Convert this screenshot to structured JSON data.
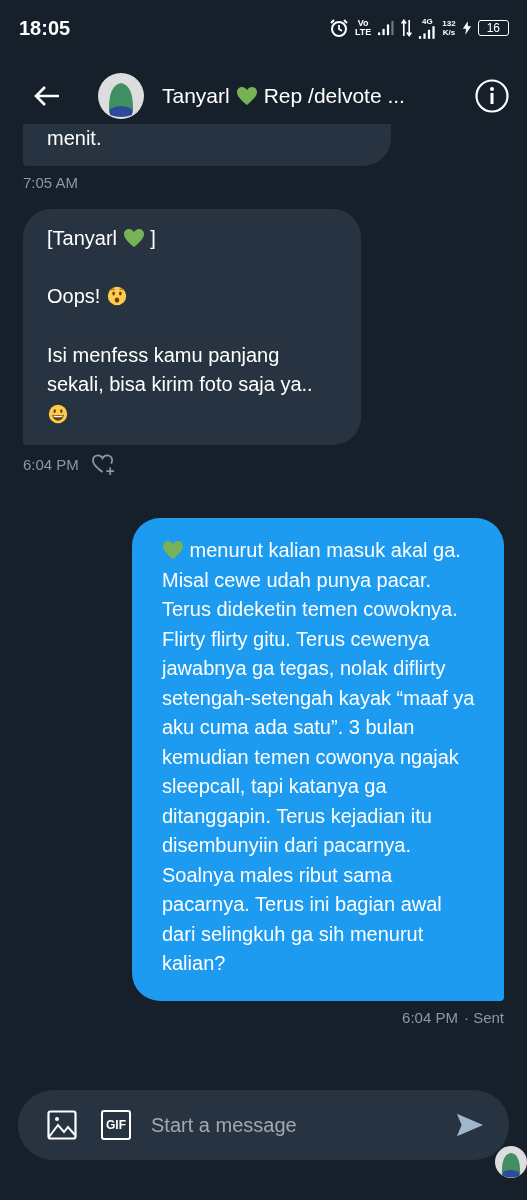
{
  "status_bar": {
    "time": "18:05",
    "volte_top": "Vo",
    "volte_bottom": "LTE",
    "network": "4G",
    "speed_value": "132",
    "speed_unit": "K/s",
    "battery": "16"
  },
  "header": {
    "name": "Tanyarl",
    "subtitle": "Rep /delvote ..."
  },
  "messages": [
    {
      "kind": "received",
      "paragraphs": [
        [
          {
            "kind": "text",
            "text": "menit."
          }
        ]
      ],
      "time": "7:05 AM",
      "partial": true,
      "react": false
    },
    {
      "kind": "received",
      "paragraphs": [
        [
          {
            "kind": "text",
            "text": "[Tanyarl"
          },
          {
            "kind": "green-heart"
          },
          {
            "kind": "text",
            "text": "]"
          }
        ],
        [
          {
            "kind": "text",
            "text": "Oops!"
          },
          {
            "kind": "surprised"
          }
        ],
        [
          {
            "kind": "text",
            "text": "Isi menfess kamu panjang sekali, bisa kirim foto saja ya.."
          },
          {
            "kind": "grin"
          }
        ]
      ],
      "time": "6:04 PM",
      "react": true,
      "partial": false
    },
    {
      "kind": "sent",
      "paragraphs": [
        [
          {
            "kind": "green-heart"
          },
          {
            "kind": "text",
            "text": "menurut kalian masuk akal ga. Misal cewe udah punya pacar. Terus dideketin temen cowoknya. Flirty flirty gitu. Terus cewenya jawabnya ga tegas, nolak diflirty setengah-setengah kayak “maaf ya aku cuma ada satu”. 3 bulan kemudian temen cowonya ngajak sleepcall, tapi katanya ga ditanggapin. Terus kejadian itu disembunyiin dari pacarnya. Soalnya males ribut sama pacarnya. Terus ini bagian awal dari selingkuh ga sih menurut kalian?"
          }
        ]
      ],
      "time": "6:04 PM",
      "status": "· Sent",
      "partial": false,
      "react": false
    }
  ],
  "composer": {
    "placeholder": "Start a message",
    "gif_label": "GIF"
  }
}
